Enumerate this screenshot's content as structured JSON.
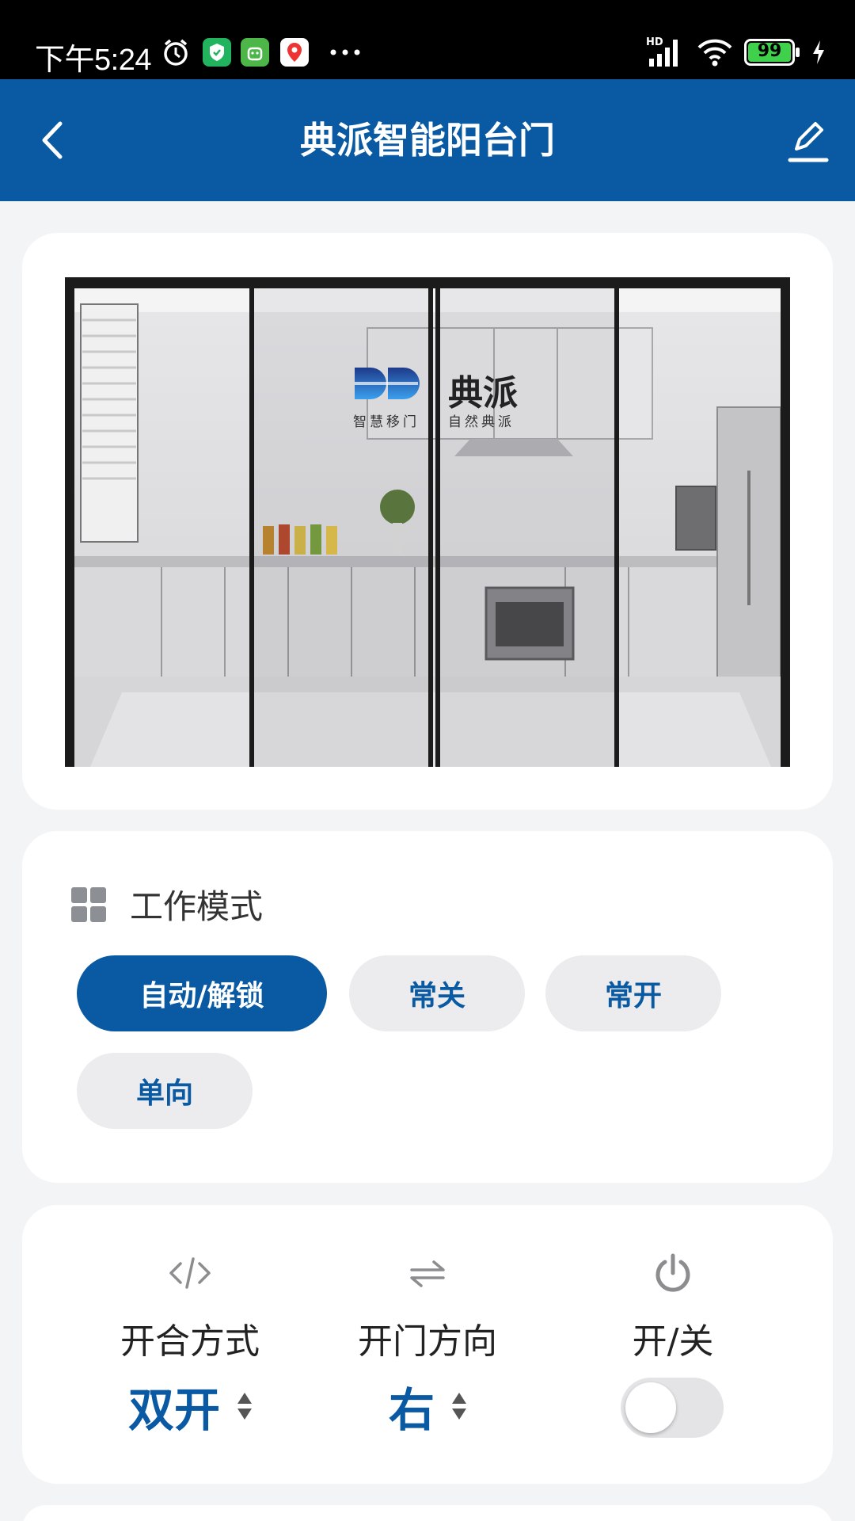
{
  "status_bar": {
    "time": "下午5:24",
    "battery": "99",
    "network": "HD"
  },
  "header": {
    "title": "典派智能阳台门"
  },
  "door_image": {
    "brand_name": "典派",
    "slogan_left": "智慧移门",
    "slogan_right": "自然典派"
  },
  "work_mode": {
    "title": "工作模式",
    "options": [
      "自动/解锁",
      "常关",
      "常开",
      "单向"
    ],
    "selected": "自动/解锁"
  },
  "controls": {
    "open_type": {
      "label": "开合方式",
      "value": "双开",
      "icon": "code-icon"
    },
    "open_direction": {
      "label": "开门方向",
      "value": "右",
      "icon": "swap-arrows-icon"
    },
    "power": {
      "label": "开/关",
      "icon": "power-icon",
      "on": false
    }
  },
  "colors": {
    "primary": "#0a5aa3",
    "background": "#f3f4f6",
    "chip": "#ececee"
  }
}
